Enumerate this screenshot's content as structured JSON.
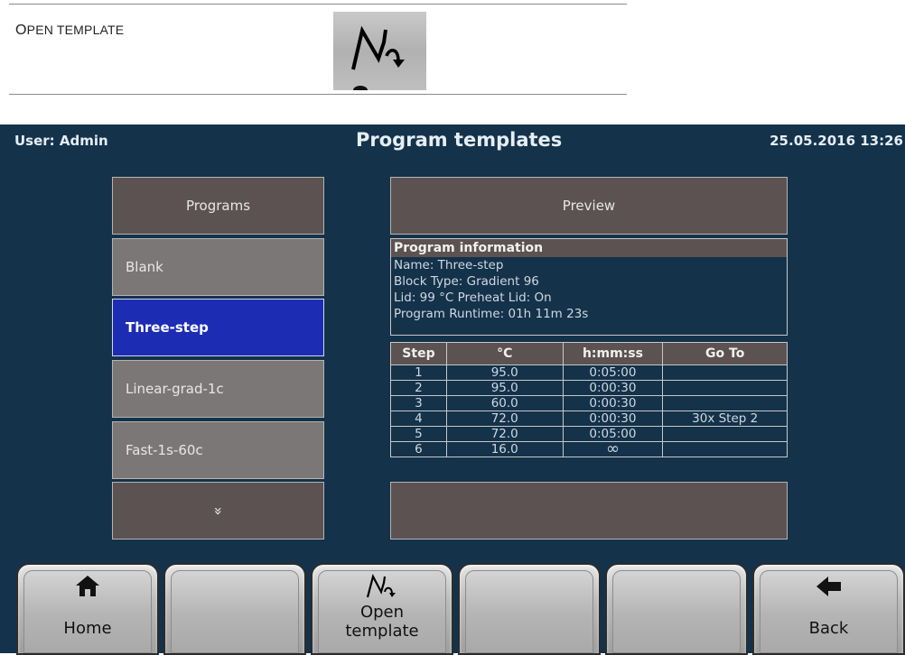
{
  "doc": {
    "label_prefix": "O",
    "label_rest": "PEN TEMPLATE"
  },
  "status_bar": {
    "user": "User: Admin",
    "title": "Program templates",
    "datetime": "25.05.2016  13:26"
  },
  "programs": {
    "header": "Programs",
    "items": [
      "Blank",
      "Three-step",
      "Linear-grad-1c",
      "Fast-1s-60c"
    ],
    "selected": "Three-step",
    "scroll_glyph": "»"
  },
  "preview": {
    "header": "Preview",
    "info_title": "Program information",
    "name": "Name: Three-step",
    "block_type": "Block Type: Gradient 96",
    "lid": "Lid: 99 °C  Preheat Lid: On",
    "runtime": "Program Runtime: 01h 11m 23s"
  },
  "steps_table": {
    "headers": [
      "Step",
      "°C",
      "h:mm:ss",
      "Go To"
    ],
    "rows": [
      [
        "1",
        "95.0",
        "0:05:00",
        ""
      ],
      [
        "2",
        "95.0",
        "0:00:30",
        ""
      ],
      [
        "3",
        "60.0",
        "0:00:30",
        ""
      ],
      [
        "4",
        "72.0",
        "0:00:30",
        "30x Step 2"
      ],
      [
        "5",
        "72.0",
        "0:05:00",
        ""
      ],
      [
        "6",
        "16.0",
        "∞",
        ""
      ]
    ]
  },
  "bottom_buttons": {
    "home": "Home",
    "open_template_1": "Open",
    "open_template_2": "template",
    "back": "Back"
  }
}
